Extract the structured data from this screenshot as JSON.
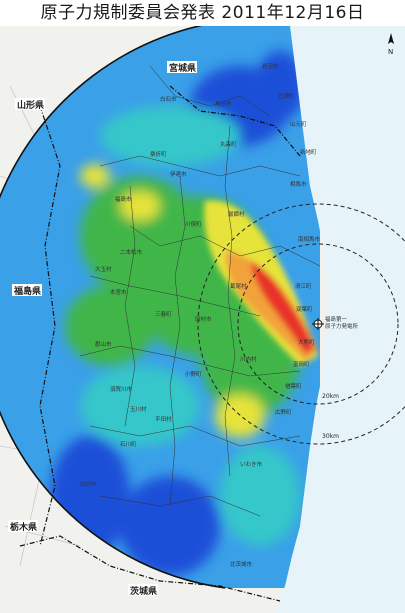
{
  "title": "原子力規制委員会発表 2011年12月16日",
  "north": "N",
  "colors": {
    "sea": "#e6f4fa",
    "land_outside": "#f1f1ee",
    "level_1": "#1f4fd8",
    "level_2": "#3aa0e8",
    "level_3": "#35c7c9",
    "level_4": "#41b649",
    "level_5": "#e6e33a",
    "level_6": "#f2a23a",
    "level_7": "#e8322a"
  },
  "prefectures": {
    "miyagi": "宮城県",
    "yamagata": "山形県",
    "fukushima": "福島県",
    "tochigi": "栃木県",
    "ibaraki": "茨城県"
  },
  "plant": {
    "line1": "福島第一",
    "line2": "原子力発電所"
  },
  "rings": {
    "r20": "20km",
    "r30": "30km"
  },
  "towns": {
    "soma": "相馬市",
    "minamisoma": "南相馬市",
    "iitate": "飯舘村",
    "kawamata": "川俣町",
    "katsurao": "葛尾村",
    "namie": "浪江町",
    "futaba": "双葉町",
    "okuma": "大熊町",
    "tomioka": "富岡町",
    "naraha": "楢葉町",
    "hirono": "広野町",
    "kawauchi": "川内村",
    "tamura": "田村市",
    "nihonmatsu": "二本松市",
    "fukushima": "福島市",
    "date": "伊達市",
    "koriyama": "郡山市",
    "iwaki": "いわき市",
    "sukagawa": "須賀川市",
    "shirakawa": "白河市",
    "ono": "小野町",
    "hirata": "平田村",
    "kitaibaraki": "北茨城市",
    "marumori": "丸森町",
    "shiroishi": "白石市",
    "kakuda": "角田市",
    "shinchi": "新地町",
    "tamagawa": "玉川村",
    "ishikawa": "石川町",
    "miharu": "三春町",
    "otama": "大玉村",
    "motomiya": "本宮市",
    "kori": "桑折町",
    "iwanuma": "岩沼市",
    "watari": "亘理町",
    "yamamoto": "山元町"
  }
}
